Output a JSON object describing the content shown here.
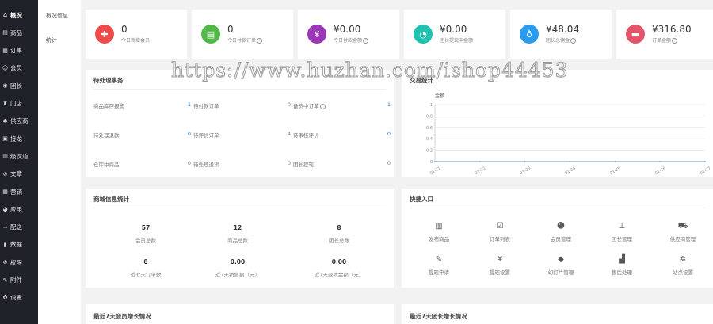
{
  "sidebar": {
    "items": [
      {
        "icon": "home-icon",
        "label": "概况"
      },
      {
        "icon": "goods-icon",
        "label": "商品"
      },
      {
        "icon": "order-icon",
        "label": "订单"
      },
      {
        "icon": "member-icon",
        "label": "会员"
      },
      {
        "icon": "leader-icon",
        "label": "团长"
      },
      {
        "icon": "store-icon",
        "label": "门店"
      },
      {
        "icon": "supplier-icon",
        "label": "供应商"
      },
      {
        "icon": "solitaire-icon",
        "label": "接龙"
      },
      {
        "icon": "delivery-icon",
        "label": "级次道"
      },
      {
        "icon": "article-icon",
        "label": "文章"
      },
      {
        "icon": "marketing-icon",
        "label": "营销"
      },
      {
        "icon": "app-icon",
        "label": "应用"
      },
      {
        "icon": "shipping-icon",
        "label": "配送"
      },
      {
        "icon": "data-icon",
        "label": "数据"
      },
      {
        "icon": "permission-icon",
        "label": "权限"
      },
      {
        "icon": "attachment-icon",
        "label": "附件"
      },
      {
        "icon": "settings-icon",
        "label": "设置"
      }
    ]
  },
  "submenu": {
    "items": [
      "概况信息",
      "统计"
    ]
  },
  "stats": [
    {
      "icon": "add-member-icon",
      "color": "#f04b4b",
      "value": "0",
      "label": "今日新增会员",
      "help": false
    },
    {
      "icon": "order-doc-icon",
      "color": "#52b848",
      "value": "0",
      "label": "今日付款订单",
      "help": true
    },
    {
      "icon": "yuan-icon",
      "color": "#9c38b8",
      "value": "¥0.00",
      "label": "今日付款金额",
      "help": true
    },
    {
      "icon": "pie-icon",
      "color": "#1fc2b0",
      "value": "¥0.00",
      "label": "团长提现中金额",
      "help": false
    },
    {
      "icon": "moneybag-icon",
      "color": "#2a9cf0",
      "value": "¥48.04",
      "label": "团长总佣金",
      "help": true
    },
    {
      "icon": "bill-icon",
      "color": "#e2556a",
      "value": "¥316.80",
      "label": "订单金额",
      "help": true
    }
  ],
  "watermark": "https://www.huzhan.com/ishop44453",
  "todo": {
    "title": "待处理事务",
    "items": [
      {
        "label": "商品库存报警",
        "value": "1",
        "blue": true,
        "help": false
      },
      {
        "label": "待付款订单",
        "value": "0",
        "blue": false,
        "help": false
      },
      {
        "label": "备货中订单",
        "value": "1",
        "blue": true,
        "help": true
      },
      {
        "label": "待处理退款",
        "value": "0",
        "blue": true,
        "help": false
      },
      {
        "label": "待评价订单",
        "value": "4",
        "blue": false,
        "help": false
      },
      {
        "label": "待审核评价",
        "value": "0",
        "blue": true,
        "help": false
      },
      {
        "label": "仓库中商品",
        "value": "0",
        "blue": false,
        "help": false
      },
      {
        "label": "待处理退货",
        "value": "0",
        "blue": false,
        "help": false
      },
      {
        "label": "团长提现",
        "value": "0",
        "blue": false,
        "help": false
      }
    ]
  },
  "trade": {
    "title": "交易统计",
    "chart_data": {
      "type": "line",
      "title": "",
      "legend": "金额",
      "x": [
        "01-21",
        "01-22",
        "01-23",
        "01-24",
        "01-25",
        "01-26",
        "01-27"
      ],
      "series": [
        {
          "name": "金额",
          "values": [
            0,
            0,
            0,
            0,
            0,
            0,
            0
          ]
        }
      ],
      "yticks": [
        "1",
        "0.9",
        "0.8",
        "0.7",
        "0.6",
        "0.5",
        "0.4",
        "0.3",
        "0.2",
        "0.1",
        "0"
      ],
      "ylim": [
        0,
        1
      ],
      "grid": true,
      "color": "#6f8fb8"
    }
  },
  "mall": {
    "title": "商城信息统计",
    "stats": [
      {
        "value": "57",
        "label": "会员总数"
      },
      {
        "value": "12",
        "label": "商品总数"
      },
      {
        "value": "8",
        "label": "团长总数"
      },
      {
        "value": "0",
        "label": "近七天订单数"
      },
      {
        "value": "0.00",
        "label": "近7天销售额（元）"
      },
      {
        "value": "0.00",
        "label": "近7天退款金额（元）"
      }
    ]
  },
  "quick": {
    "title": "快捷入口",
    "items": [
      {
        "icon": "barcode-icon",
        "glyph": "▥",
        "label": "发布商品"
      },
      {
        "icon": "clipboard-check-icon",
        "glyph": "☑",
        "label": "订单列表"
      },
      {
        "icon": "user-manage-icon",
        "glyph": "☻",
        "label": "会员管理"
      },
      {
        "icon": "org-chart-icon",
        "glyph": "⊥",
        "label": "团长管理"
      },
      {
        "icon": "truck-icon",
        "glyph": "⛟",
        "label": "供应商管理"
      },
      {
        "icon": "withdraw-icon",
        "glyph": "✎",
        "label": "提现申请"
      },
      {
        "icon": "yen-settings-icon",
        "glyph": "¥",
        "label": "提现设置"
      },
      {
        "icon": "tag-icon",
        "glyph": "◆",
        "label": "幻灯片管理"
      },
      {
        "icon": "after-sale-icon",
        "glyph": "▟",
        "label": "售后处理"
      },
      {
        "icon": "gear-icon",
        "glyph": "✲",
        "label": "站点设置"
      }
    ]
  },
  "bottom": {
    "left_title": "最近7天会员增长情况",
    "right_title": "最近7天团长增长情况"
  }
}
